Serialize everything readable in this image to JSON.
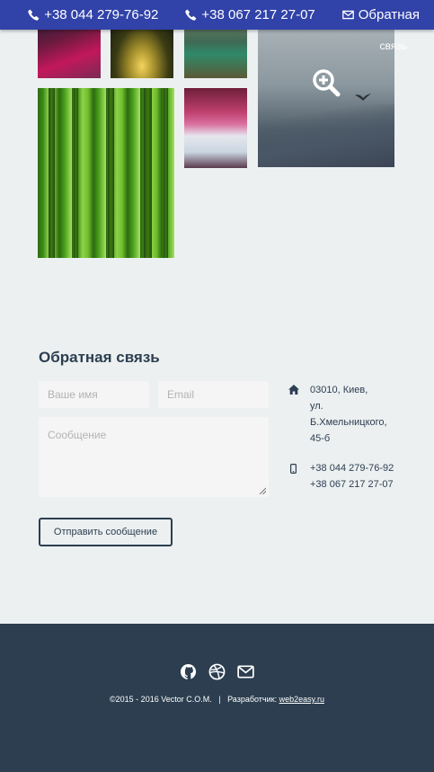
{
  "topbar": {
    "phone1": "+38 044 279-76-92",
    "phone2": "+38 067 217 27-07",
    "feedback_link": "Обратная",
    "feedback_overflow": "связь",
    "bg_color": "#3142a8"
  },
  "gallery": {
    "tiles": [
      "red-forest",
      "sunset-path",
      "valley",
      "misty-mountains",
      "bamboo",
      "pink-waterfall"
    ]
  },
  "contact": {
    "title": "Обратная связь",
    "name_placeholder": "Ваше имя",
    "email_placeholder": "Email",
    "message_placeholder": "Сообщение",
    "send_label": "Отправить сообщение",
    "address_lines": [
      "03010, Киев,",
      "ул.",
      "Б.Хмельницкого,",
      "45-б"
    ],
    "phones": [
      "+38 044 279-76-92",
      "+38 067 217 27-07"
    ]
  },
  "footer": {
    "copyright": "©2015 - 2016 Vector C.O.M.",
    "separator": "|",
    "developer_label": "Разработчик:",
    "developer_link": "web2easy.ru",
    "icons": [
      "github-icon",
      "dribbble-icon",
      "mail-icon"
    ],
    "bg_color": "#2c3e50"
  }
}
